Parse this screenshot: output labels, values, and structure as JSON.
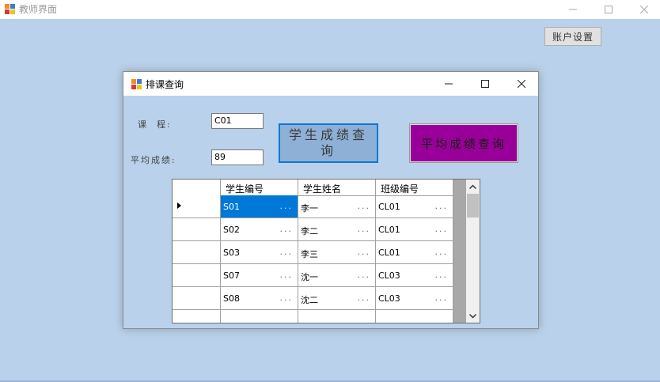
{
  "window": {
    "title": "教师界面",
    "account_button": "账户设置"
  },
  "dialog": {
    "title": "排课查询",
    "course_label": "课  程:",
    "course_value": "C01",
    "avg_label": "平均成绩:",
    "avg_value": "89",
    "score_query_button": "学生成绩查询",
    "avg_query_button": "平均成绩查询"
  },
  "grid": {
    "columns": [
      "学生编号",
      "学生姓名",
      "班级编号"
    ],
    "rows": [
      [
        "S01",
        "李一",
        "CL01"
      ],
      [
        "S02",
        "李二",
        "CL01"
      ],
      [
        "S03",
        "李三",
        "CL01"
      ],
      [
        "S07",
        "沈一",
        "CL03"
      ],
      [
        "S08",
        "沈二",
        "CL03"
      ]
    ],
    "ellipsis": "...",
    "selected_row": 0
  },
  "colors": {
    "background": "#b9d1ea",
    "selected": "#0078d7",
    "avg_button": "#990099"
  }
}
